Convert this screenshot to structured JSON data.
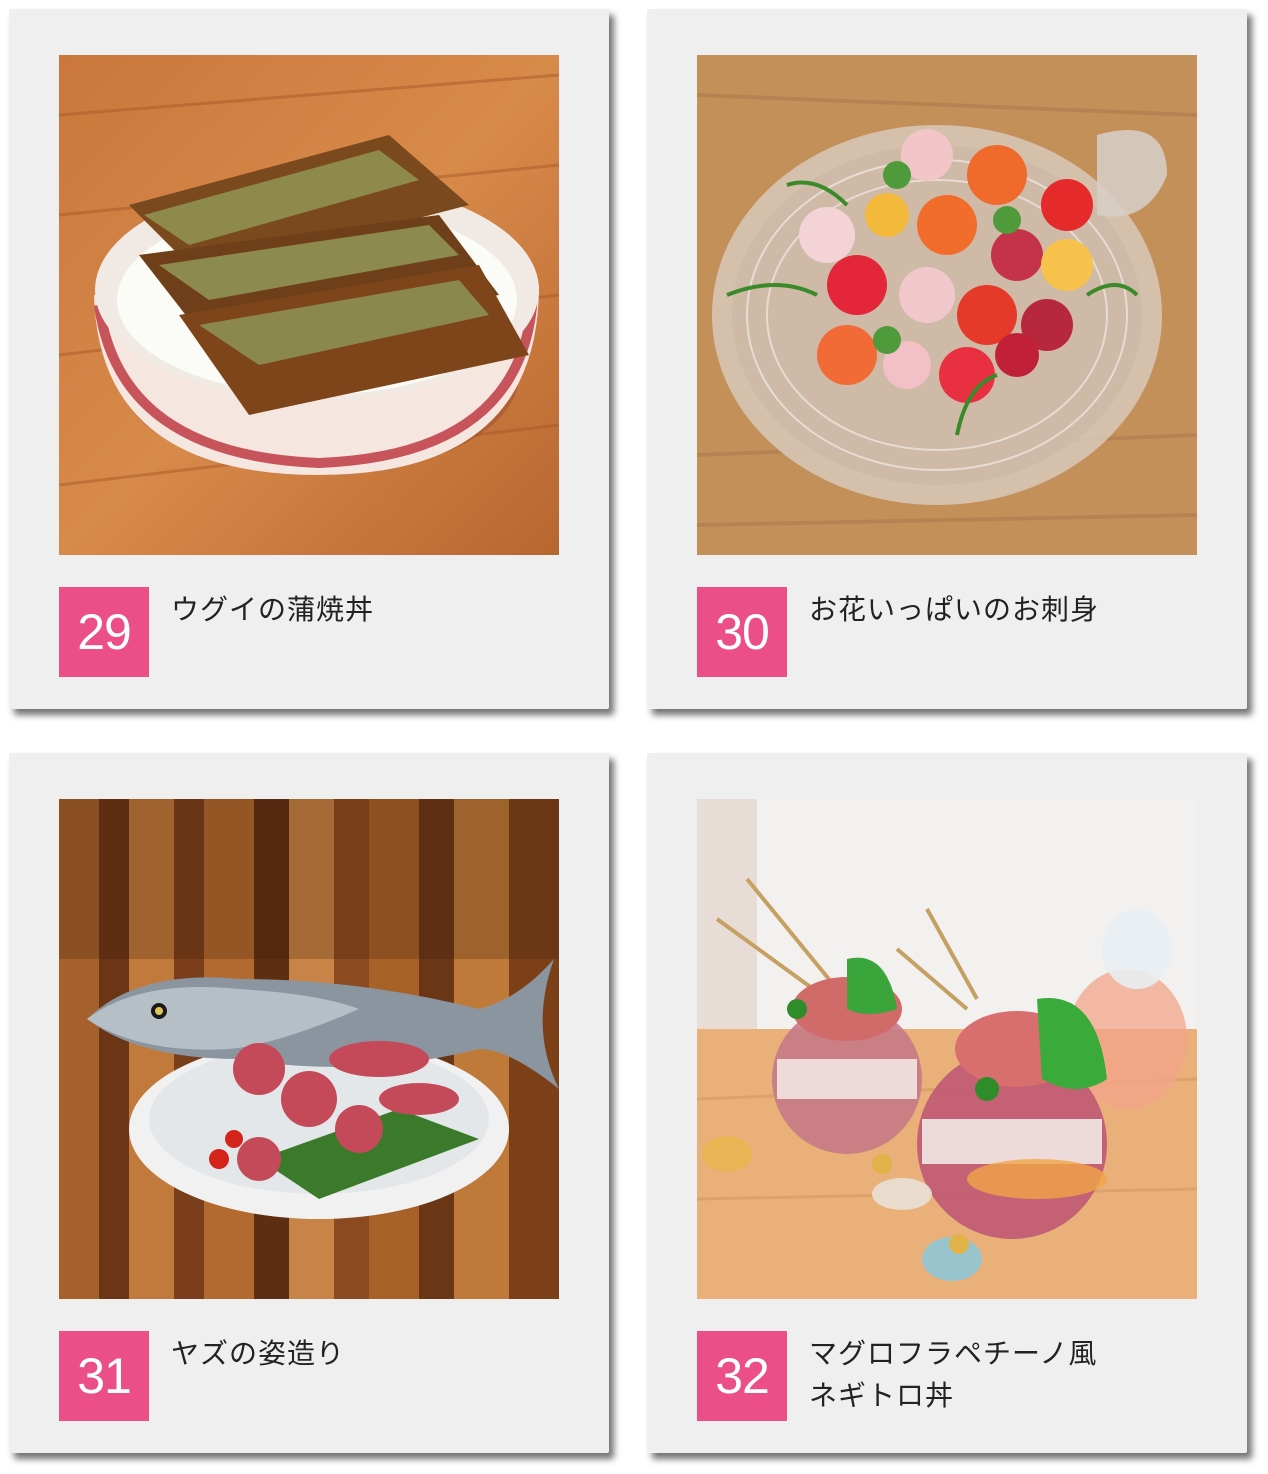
{
  "cards": [
    {
      "number": "29",
      "title_lines": [
        "ウグイの蒲焼丼"
      ]
    },
    {
      "number": "30",
      "title_lines": [
        "お花いっぱいのお刺身"
      ]
    },
    {
      "number": "31",
      "title_lines": [
        "ヤズの姿造り"
      ]
    },
    {
      "number": "32",
      "title_lines": [
        "マグロフラペチーノ風",
        "ネギトロ丼"
      ]
    }
  ],
  "colors": {
    "badge": "#ec4f88",
    "card": "#efefef"
  }
}
